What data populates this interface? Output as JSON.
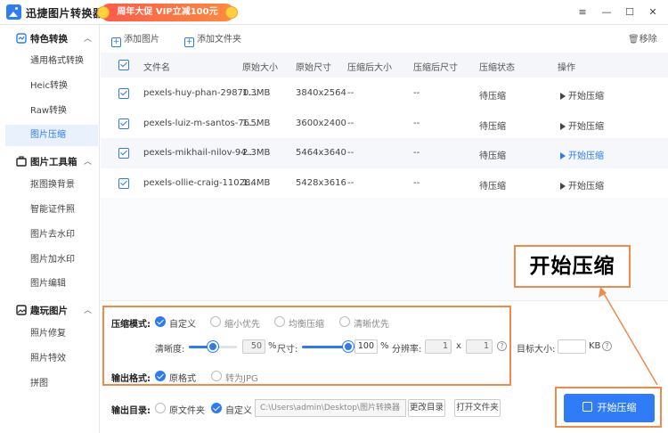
{
  "window": {
    "app_title": "迅捷图片转换器",
    "promo_text": "周年大促 VIP立减100元",
    "controls": [
      "≡",
      "—",
      "☐",
      "✕"
    ]
  },
  "sidebar": {
    "sections": [
      {
        "label": "特色转换",
        "icon": "convert-icon",
        "expanded": true,
        "items": [
          {
            "label": "通用格式转换",
            "active": false
          },
          {
            "label": "Heic转换",
            "active": false
          },
          {
            "label": "Raw转换",
            "active": false
          },
          {
            "label": "图片压缩",
            "active": true
          }
        ]
      },
      {
        "label": "图片工具箱",
        "icon": "toolbox-icon",
        "expanded": true,
        "items": [
          {
            "label": "抠图换背景",
            "active": false
          },
          {
            "label": "智能证件照",
            "active": false
          },
          {
            "label": "图片去水印",
            "active": false
          },
          {
            "label": "图片加水印",
            "active": false
          },
          {
            "label": "图片编辑",
            "active": false
          }
        ]
      },
      {
        "label": "趣玩图片",
        "icon": "fun-image-icon",
        "expanded": true,
        "items": [
          {
            "label": "照片修复",
            "active": false
          },
          {
            "label": "照片特效",
            "active": false
          },
          {
            "label": "拼图",
            "active": false
          }
        ]
      }
    ]
  },
  "toolbar": {
    "add_image": "添加图片",
    "add_folder": "添加文件夹",
    "remove": "移除"
  },
  "table": {
    "columns": [
      "文件名",
      "原始大小",
      "原始尺寸",
      "压缩后大小",
      "压缩后尺寸",
      "压缩状态",
      "操作"
    ],
    "rows": [
      {
        "name": "pexels-huy-phan-29870...",
        "size": "1.3MB",
        "dims": "3840x2564",
        "new_size": "--",
        "new_dims": "--",
        "status": "待压缩",
        "action": "开始压缩",
        "highlight": false
      },
      {
        "name": "pexels-luiz-m-santos-76...",
        "size": "1.5MB",
        "dims": "3600x2400",
        "new_size": "--",
        "new_dims": "--",
        "status": "待压缩",
        "action": "开始压缩",
        "highlight": false
      },
      {
        "name": "pexels-mikhail-nilov-94...",
        "size": "2.3MB",
        "dims": "5464x3640",
        "new_size": "--",
        "new_dims": "--",
        "status": "待压缩",
        "action": "开始压缩",
        "highlight": true
      },
      {
        "name": "pexels-ollie-craig-11028...",
        "size": "1.4MB",
        "dims": "5428x3616",
        "new_size": "--",
        "new_dims": "--",
        "status": "待压缩",
        "action": "开始压缩",
        "highlight": false
      }
    ]
  },
  "settings": {
    "mode_label": "压缩模式:",
    "modes": [
      {
        "label": "自定义",
        "selected": true
      },
      {
        "label": "缩小优先",
        "selected": false
      },
      {
        "label": "均衡压缩",
        "selected": false
      },
      {
        "label": "清晰优先",
        "selected": false
      }
    ],
    "clarity_label": "清晰度:",
    "clarity_value": "50",
    "clarity_level": 0.5,
    "size_label": "尺寸:",
    "size_value": "100",
    "size_level": 1.0,
    "percent": "%",
    "resolution_label": "分辨率:",
    "res_w": "1",
    "res_x": "x",
    "res_h": "1",
    "help": "?",
    "target_label": "目标大小:",
    "target_value": "",
    "target_unit": "KB",
    "format_label": "输出格式:",
    "formats": [
      {
        "label": "原格式",
        "selected": true
      },
      {
        "label": "转为JPG",
        "selected": false
      }
    ],
    "dir_label": "输出目录:",
    "dirs": [
      {
        "label": "原文件夹",
        "selected": false
      },
      {
        "label": "自定义",
        "selected": true
      }
    ],
    "path": "C:\\Users\\admin\\Desktop\\图片转换器",
    "change_dir": "更改目录",
    "open_folder": "打开文件夹",
    "start": "开始压缩"
  },
  "annotation": {
    "callout": "开始压缩",
    "color": "#f08a4a"
  },
  "colors": {
    "accent": "#2f7cf6",
    "annotation": "#f08a4a",
    "promo": "#ff5a4a"
  }
}
